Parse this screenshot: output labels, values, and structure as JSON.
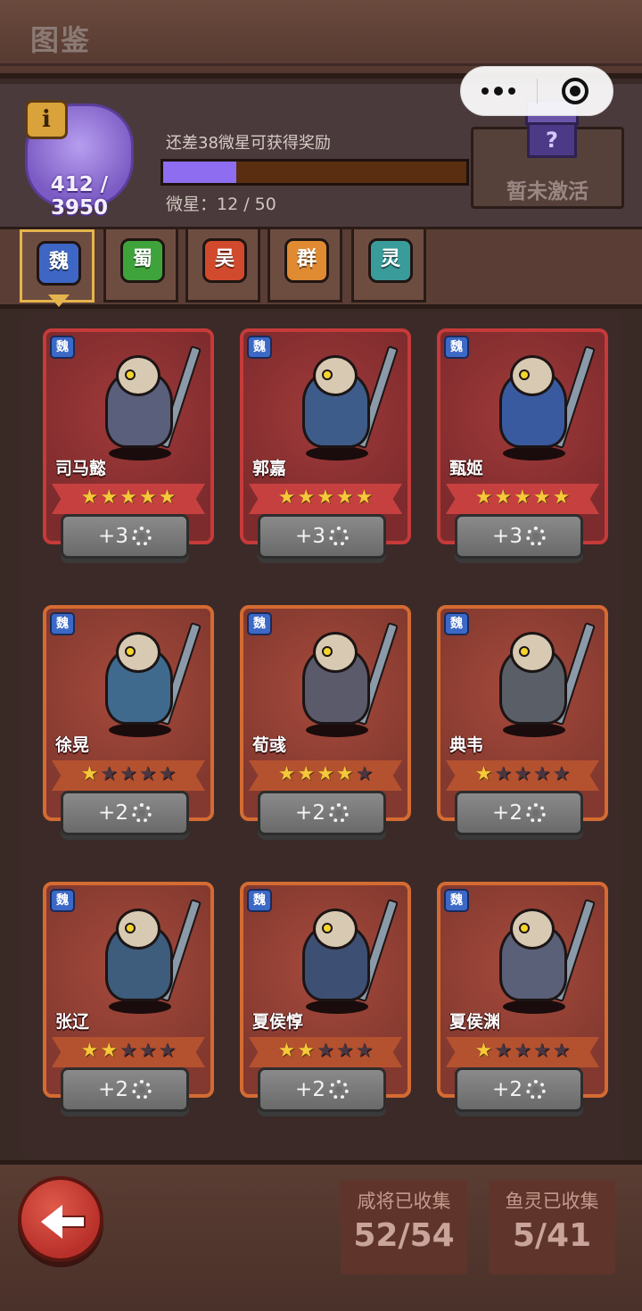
{
  "title": "图鉴",
  "header": {
    "star_total": "412 / 3950",
    "reward_tip": "还差38微星可获得奖励",
    "progress_fraction": 0.24,
    "micro_star": "微星：12 / 50",
    "inactive_label": "暂未激活",
    "info_label": "i",
    "chest_mark": "?"
  },
  "tabs": [
    {
      "label": "魏",
      "color": "#3e66c4",
      "active": true
    },
    {
      "label": "蜀",
      "color": "#3fa33c",
      "active": false
    },
    {
      "label": "吴",
      "color": "#d24a2d",
      "active": false
    },
    {
      "label": "群",
      "color": "#e08a32",
      "active": false
    },
    {
      "label": "灵",
      "color": "#3a9c9a",
      "active": false
    }
  ],
  "faction_mark": "魏",
  "cards": [
    {
      "name": "司马懿",
      "stars": 5,
      "upgrade": "+3",
      "rarity": "red"
    },
    {
      "name": "郭嘉",
      "stars": 5,
      "upgrade": "+3",
      "rarity": "red"
    },
    {
      "name": "甄姬",
      "stars": 5,
      "upgrade": "+3",
      "rarity": "red"
    },
    {
      "name": "徐晃",
      "stars": 1,
      "upgrade": "+2",
      "rarity": "orange"
    },
    {
      "name": "荀彧",
      "stars": 4,
      "upgrade": "+2",
      "rarity": "orange"
    },
    {
      "name": "典韦",
      "stars": 1,
      "upgrade": "+2",
      "rarity": "orange"
    },
    {
      "name": "张辽",
      "stars": 2,
      "upgrade": "+2",
      "rarity": "orange"
    },
    {
      "name": "夏侯惇",
      "stars": 2,
      "upgrade": "+2",
      "rarity": "orange"
    },
    {
      "name": "夏侯渊",
      "stars": 1,
      "upgrade": "+2",
      "rarity": "orange"
    }
  ],
  "footer": {
    "generals_label": "咸将已收集",
    "generals_value": "52/54",
    "spirits_label": "鱼灵已收集",
    "spirits_value": "5/41"
  }
}
